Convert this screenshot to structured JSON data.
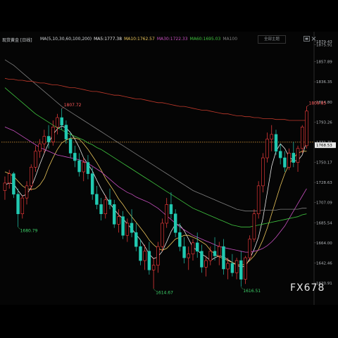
{
  "header": {
    "instrument": "现货黄金 [日线]",
    "ma_label": "MA(5,10,30,60,100,200)",
    "ma_items": [
      {
        "text": "MA5:1777.38",
        "color": "#e8e8e8"
      },
      {
        "text": "MA10:1762.57",
        "color": "#e8c35a"
      },
      {
        "text": "MA30:1722.33",
        "color": "#c850c0"
      },
      {
        "text": "MA60:1695.03",
        "color": "#3fc43f"
      },
      {
        "text": "MA100",
        "color": "#7f7f7f"
      }
    ],
    "settings_label": "全部主题"
  },
  "watermark": "FX678",
  "chart_data": {
    "type": "candlestick",
    "current_price": "1771.72",
    "current_price_box": "1768.53",
    "yticks": [
      "1879.43",
      "1875.91",
      "1857.89",
      "1836.35",
      "1814.80",
      "1793.26",
      "1771.72",
      "1750.17",
      "1728.63",
      "1707.09",
      "1685.54",
      "1664.00",
      "1642.46",
      "1620.91"
    ],
    "ylim": [
      1620.91,
      1879.43
    ],
    "annotations": [
      {
        "text": "1807.72",
        "value": 1807.72,
        "index": 13,
        "color": "#ff5a5a"
      },
      {
        "text": "1680.79",
        "value": 1680.79,
        "index": 3,
        "color": "#3ed46a"
      },
      {
        "text": "1614.67",
        "value": 1614.67,
        "index": 34,
        "color": "#3ed46a"
      },
      {
        "text": "1616.51",
        "value": 1616.51,
        "index": 54,
        "color": "#3ed46a"
      },
      {
        "text": "1809.85",
        "value": 1809.85,
        "index": 69,
        "color": "#ff5a5a"
      }
    ],
    "candles": [
      [
        1720,
        1735,
        1710,
        1728
      ],
      [
        1728,
        1742,
        1722,
        1738
      ],
      [
        1738,
        1740,
        1712,
        1716
      ],
      [
        1716,
        1722,
        1681,
        1695
      ],
      [
        1695,
        1715,
        1690,
        1712
      ],
      [
        1712,
        1730,
        1705,
        1725
      ],
      [
        1725,
        1748,
        1720,
        1745
      ],
      [
        1745,
        1768,
        1740,
        1762
      ],
      [
        1762,
        1775,
        1755,
        1770
      ],
      [
        1770,
        1785,
        1760,
        1778
      ],
      [
        1778,
        1790,
        1765,
        1772
      ],
      [
        1772,
        1795,
        1768,
        1788
      ],
      [
        1788,
        1802,
        1780,
        1798
      ],
      [
        1798,
        1808,
        1785,
        1790
      ],
      [
        1790,
        1795,
        1770,
        1775
      ],
      [
        1775,
        1782,
        1755,
        1760
      ],
      [
        1760,
        1768,
        1745,
        1752
      ],
      [
        1752,
        1760,
        1735,
        1740
      ],
      [
        1740,
        1755,
        1730,
        1750
      ],
      [
        1750,
        1758,
        1732,
        1738
      ],
      [
        1738,
        1745,
        1710,
        1716
      ],
      [
        1716,
        1725,
        1700,
        1705
      ],
      [
        1705,
        1712,
        1688,
        1695
      ],
      [
        1695,
        1715,
        1690,
        1710
      ],
      [
        1710,
        1722,
        1700,
        1705
      ],
      [
        1705,
        1710,
        1680,
        1684
      ],
      [
        1684,
        1700,
        1675,
        1692
      ],
      [
        1692,
        1698,
        1668,
        1672
      ],
      [
        1672,
        1690,
        1665,
        1685
      ],
      [
        1685,
        1700,
        1670,
        1675
      ],
      [
        1675,
        1685,
        1655,
        1660
      ],
      [
        1660,
        1668,
        1640,
        1645
      ],
      [
        1645,
        1662,
        1635,
        1655
      ],
      [
        1655,
        1665,
        1630,
        1635
      ],
      [
        1635,
        1648,
        1615,
        1640
      ],
      [
        1640,
        1665,
        1632,
        1660
      ],
      [
        1660,
        1690,
        1655,
        1685
      ],
      [
        1685,
        1712,
        1680,
        1705
      ],
      [
        1705,
        1718,
        1690,
        1695
      ],
      [
        1695,
        1700,
        1670,
        1675
      ],
      [
        1675,
        1685,
        1655,
        1660
      ],
      [
        1660,
        1670,
        1642,
        1648
      ],
      [
        1648,
        1660,
        1635,
        1652
      ],
      [
        1652,
        1668,
        1645,
        1664
      ],
      [
        1664,
        1675,
        1648,
        1655
      ],
      [
        1655,
        1662,
        1632,
        1638
      ],
      [
        1638,
        1650,
        1628,
        1645
      ],
      [
        1645,
        1660,
        1640,
        1655
      ],
      [
        1655,
        1670,
        1645,
        1650
      ],
      [
        1650,
        1665,
        1640,
        1660
      ],
      [
        1660,
        1668,
        1630,
        1636
      ],
      [
        1636,
        1648,
        1625,
        1642
      ],
      [
        1642,
        1652,
        1628,
        1632
      ],
      [
        1632,
        1648,
        1625,
        1645
      ],
      [
        1645,
        1655,
        1617,
        1625
      ],
      [
        1625,
        1650,
        1620,
        1648
      ],
      [
        1648,
        1672,
        1645,
        1668
      ],
      [
        1668,
        1700,
        1665,
        1695
      ],
      [
        1695,
        1730,
        1690,
        1725
      ],
      [
        1725,
        1760,
        1718,
        1755
      ],
      [
        1755,
        1782,
        1750,
        1775
      ],
      [
        1775,
        1790,
        1762,
        1780
      ],
      [
        1780,
        1785,
        1758,
        1762
      ],
      [
        1762,
        1770,
        1748,
        1755
      ],
      [
        1755,
        1762,
        1740,
        1745
      ],
      [
        1745,
        1765,
        1742,
        1760
      ],
      [
        1760,
        1772,
        1745,
        1750
      ],
      [
        1750,
        1768,
        1740,
        1765
      ],
      [
        1765,
        1790,
        1760,
        1788
      ],
      [
        1768,
        1810,
        1765,
        1805
      ]
    ],
    "ma_lines": [
      {
        "name": "MA5",
        "color": "#e8e8e8",
        "values": [
          1726,
          1728,
          1727,
          1720,
          1714,
          1716,
          1723,
          1735,
          1748,
          1760,
          1771,
          1780,
          1786,
          1789,
          1787,
          1782,
          1775,
          1766,
          1755,
          1748,
          1741,
          1731,
          1722,
          1714,
          1706,
          1700,
          1694,
          1690,
          1684,
          1679,
          1673,
          1667,
          1660,
          1652,
          1647,
          1649,
          1655,
          1665,
          1676,
          1684,
          1683,
          1677,
          1668,
          1659,
          1656,
          1652,
          1649,
          1645,
          1648,
          1650,
          1649,
          1646,
          1643,
          1640,
          1638,
          1639,
          1647,
          1657,
          1670,
          1690,
          1718,
          1746,
          1762,
          1770,
          1765,
          1756,
          1752,
          1752,
          1758,
          1772
        ]
      },
      {
        "name": "MA10",
        "color": "#e8c35a",
        "values": [
          1740,
          1738,
          1735,
          1730,
          1725,
          1722,
          1721,
          1722,
          1726,
          1733,
          1745,
          1755,
          1764,
          1771,
          1774,
          1776,
          1776,
          1775,
          1770,
          1764,
          1757,
          1750,
          1742,
          1733,
          1726,
          1719,
          1711,
          1705,
          1698,
          1692,
          1686,
          1680,
          1674,
          1667,
          1662,
          1658,
          1656,
          1658,
          1663,
          1668,
          1670,
          1672,
          1672,
          1670,
          1668,
          1665,
          1662,
          1656,
          1652,
          1649,
          1647,
          1645,
          1643,
          1641,
          1640,
          1641,
          1645,
          1650,
          1657,
          1667,
          1680,
          1695,
          1710,
          1725,
          1738,
          1748,
          1755,
          1760,
          1762,
          1762
        ]
      },
      {
        "name": "MA30",
        "color": "#c850c0",
        "values": [
          1788,
          1786,
          1784,
          1781,
          1778,
          1775,
          1772,
          1769,
          1766,
          1764,
          1762,
          1760,
          1758,
          1757,
          1756,
          1755,
          1754,
          1753,
          1751,
          1749,
          1746,
          1743,
          1740,
          1736,
          1732,
          1728,
          1724,
          1721,
          1718,
          1716,
          1713,
          1711,
          1709,
          1707,
          1704,
          1701,
          1697,
          1693,
          1689,
          1685,
          1681,
          1678,
          1675,
          1672,
          1670,
          1668,
          1666,
          1664,
          1662,
          1660,
          1659,
          1658,
          1657,
          1656,
          1655,
          1654,
          1654,
          1655,
          1656,
          1658,
          1661,
          1665,
          1670,
          1676,
          1682,
          1690,
          1698,
          1706,
          1714,
          1722
        ]
      },
      {
        "name": "MA60",
        "color": "#3fc43f",
        "values": [
          1830,
          1826,
          1822,
          1818,
          1814,
          1810,
          1806,
          1802,
          1799,
          1796,
          1793,
          1790,
          1787,
          1785,
          1782,
          1780,
          1778,
          1776,
          1774,
          1771,
          1769,
          1766,
          1764,
          1761,
          1758,
          1755,
          1752,
          1749,
          1746,
          1743,
          1740,
          1737,
          1734,
          1731,
          1728,
          1725,
          1722,
          1719,
          1716,
          1713,
          1710,
          1707,
          1704,
          1701,
          1699,
          1697,
          1695,
          1693,
          1691,
          1689,
          1687,
          1685,
          1683,
          1682,
          1681,
          1681,
          1681,
          1682,
          1683,
          1684,
          1685,
          1686,
          1687,
          1688,
          1689,
          1690,
          1691,
          1692,
          1694,
          1695
        ]
      },
      {
        "name": "MA100",
        "color": "#7f7f7f",
        "values": [
          1860,
          1857,
          1854,
          1850,
          1846,
          1842,
          1838,
          1834,
          1830,
          1826,
          1822,
          1818,
          1814,
          1810,
          1807,
          1804,
          1801,
          1798,
          1795,
          1792,
          1789,
          1786,
          1783,
          1780,
          1777,
          1774,
          1771,
          1768,
          1765,
          1762,
          1759,
          1756,
          1753,
          1750,
          1747,
          1744,
          1741,
          1738,
          1735,
          1732,
          1729,
          1726,
          1723,
          1720,
          1718,
          1716,
          1714,
          1712,
          1710,
          1708,
          1706,
          1704,
          1702,
          1700,
          1699,
          1698,
          1698,
          1698,
          1698,
          1699,
          1699,
          1699,
          1699,
          1700,
          1700,
          1700,
          1700,
          1700,
          1701,
          1701
        ]
      },
      {
        "name": "MA200",
        "color": "#c0392b",
        "values": [
          1840,
          1839,
          1839,
          1838,
          1838,
          1837,
          1837,
          1836,
          1835,
          1835,
          1834,
          1833,
          1833,
          1832,
          1831,
          1830,
          1830,
          1829,
          1828,
          1827,
          1826,
          1826,
          1825,
          1824,
          1823,
          1822,
          1822,
          1821,
          1820,
          1819,
          1818,
          1818,
          1817,
          1816,
          1815,
          1814,
          1814,
          1813,
          1812,
          1811,
          1810,
          1810,
          1809,
          1808,
          1807,
          1806,
          1806,
          1805,
          1804,
          1803,
          1802,
          1802,
          1801,
          1800,
          1800,
          1799,
          1799,
          1798,
          1798,
          1797,
          1797,
          1797,
          1796,
          1796,
          1796,
          1795,
          1795,
          1795,
          1795,
          1795
        ]
      }
    ]
  }
}
